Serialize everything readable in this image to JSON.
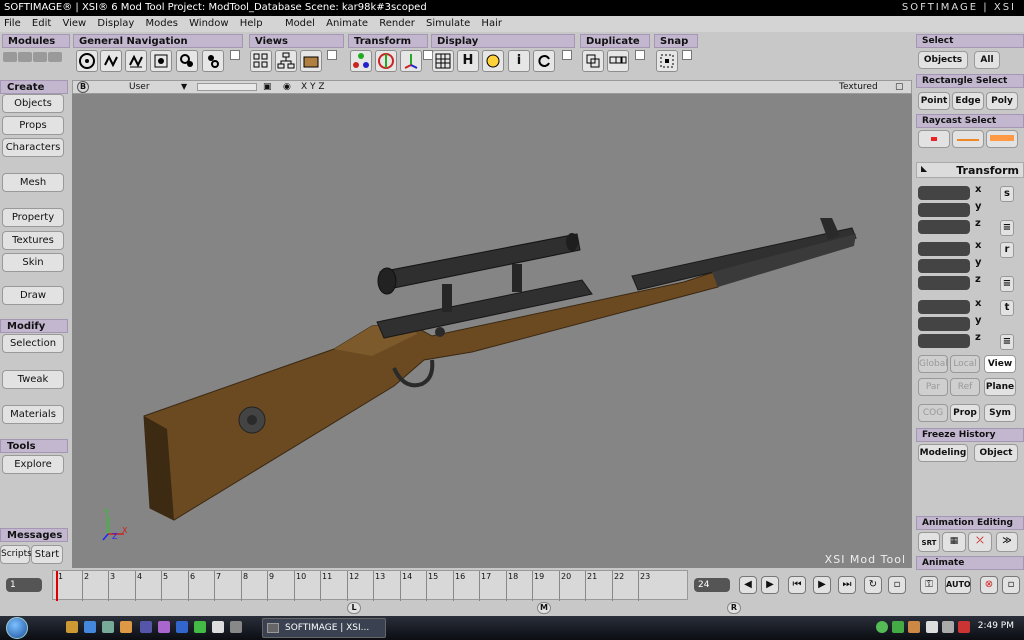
{
  "window": {
    "title": "SOFTIMAGE® | XSI® 6 Mod Tool Project: ModTool_Database    Scene: kar98k#3scoped",
    "logo": "SOFTIMAGE | XSI"
  },
  "menu": [
    "File",
    "Edit",
    "View",
    "Display",
    "Modes",
    "Window",
    "Help",
    "Model",
    "Animate",
    "Render",
    "Simulate",
    "Hair"
  ],
  "toolbar_groups": [
    "Modules",
    "General Navigation",
    "Views",
    "Transform",
    "Display",
    "Duplicate",
    "Snap"
  ],
  "toolbar_glyphs": {
    "display_h": "H",
    "info_i": "i"
  },
  "left_panel": {
    "create_header": "Create",
    "create_buttons": [
      "Objects",
      "Props",
      "Characters",
      "Mesh",
      "Property",
      "Textures",
      "Skin",
      "Draw"
    ],
    "modify_header": "Modify",
    "modify_buttons": [
      "Selection",
      "Tweak",
      "Materials"
    ],
    "tools_header": "Tools",
    "tools_buttons": [
      "Explore"
    ],
    "messages_header": "Messages",
    "messages_buttons": [
      "Scripts",
      "Start"
    ]
  },
  "viewport": {
    "badge": "B",
    "camera": "User",
    "axes_label": "X Y Z",
    "mode": "Textured",
    "watermark": "XSI Mod Tool",
    "axis_letters": {
      "x": "X",
      "y": "Y",
      "z": "Z"
    }
  },
  "right_panel": {
    "select_header": "Select",
    "objects_button": "Objects",
    "all_button": "All",
    "rect_header": "Rectangle Select",
    "rect_buttons": [
      "Point",
      "Edge",
      "Poly"
    ],
    "raycast_header": "Raycast Select",
    "transform_header": "Transform",
    "transform_rows": [
      {
        "side": "s",
        "axes": [
          "x",
          "y",
          "z"
        ]
      },
      {
        "side": "r",
        "axes": [
          "x",
          "y",
          "z"
        ]
      },
      {
        "side": "t",
        "axes": [
          "x",
          "y",
          "z"
        ]
      }
    ],
    "space_buttons": [
      "Global",
      "Local",
      "View"
    ],
    "ref_buttons": [
      "Par",
      "Ref",
      "Plane"
    ],
    "cog_buttons": [
      "COG",
      "Prop",
      "Sym"
    ],
    "freeze_header": "Freeze History",
    "freeze_buttons": [
      "Modeling",
      "Object"
    ],
    "anim_editing_header": "Animation Editing",
    "srt_label": "SRT",
    "animate_header": "Animate",
    "auto_button": "AUTO"
  },
  "timeline": {
    "current_frame": "1",
    "ticks": [
      "1",
      "2",
      "3",
      "4",
      "5",
      "6",
      "7",
      "8",
      "9",
      "10",
      "11",
      "12",
      "13",
      "14",
      "15",
      "16",
      "17",
      "18",
      "19",
      "20",
      "21",
      "22",
      "23"
    ],
    "end_frame": "24",
    "markers": [
      "L",
      "M",
      "R"
    ]
  },
  "taskbar": {
    "task_label": "SOFTIMAGE | XSI...",
    "clock": "2:49 PM"
  }
}
